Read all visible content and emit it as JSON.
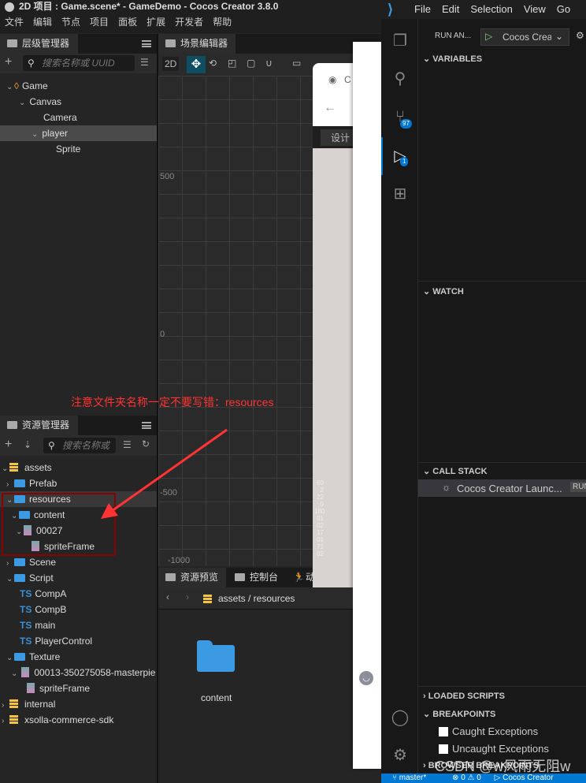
{
  "cocos": {
    "title": "2D 项目 : Game.scene* - GameDemo - Cocos Creator 3.8.0",
    "menu": [
      "文件",
      "编辑",
      "节点",
      "项目",
      "面板",
      "扩展",
      "开发者",
      "帮助"
    ],
    "hierarchy": {
      "tab": "层级管理器",
      "search_placeholder": "搜索名称或 UUID",
      "nodes": [
        {
          "label": "Game"
        },
        {
          "label": "Canvas"
        },
        {
          "label": "Camera"
        },
        {
          "label": "player"
        },
        {
          "label": "Sprite"
        }
      ]
    },
    "scene": {
      "tab": "场景编辑器",
      "mode": "2D",
      "axis_labels": [
        "500",
        "0",
        "-500",
        "-1000"
      ]
    },
    "assets": {
      "tab": "资源管理器",
      "search_placeholder": "搜索名称或",
      "tree": [
        "assets",
        "Prefab",
        "resources",
        "content",
        "00027",
        "spriteFrame",
        "Scene",
        "Script",
        "CompA",
        "CompB",
        "main",
        "PlayerControl",
        "Texture",
        "00013-350275058-masterpie",
        "spriteFrame",
        "internal",
        "xsolla-commerce-sdk"
      ]
    },
    "bottom": {
      "tabs": [
        "资源预览",
        "控制台",
        "动"
      ],
      "breadcrumb": "assets / resources",
      "item": "content"
    },
    "browser": {
      "tab_fragment": "C",
      "button": "设计",
      "side_numbers": [
        "60",
        "2",
        "22",
        "0",
        "180",
        "01",
        "02",
        "17",
        "01",
        "71",
        "02"
      ]
    }
  },
  "annotation": {
    "text": "注意文件夹名称一定不要写错：resources",
    "color": "#ff3333"
  },
  "vscode": {
    "menu": [
      "File",
      "Edit",
      "Selection",
      "View",
      "Go"
    ],
    "run_label": "RUN AN...",
    "config": "Cocos Crea",
    "sections": {
      "variables": "VARIABLES",
      "watch": "WATCH",
      "call_stack": "CALL STACK",
      "loaded_scripts": "LOADED SCRIPTS",
      "breakpoints": "BREAKPOINTS",
      "browser_breakpoints": "BROWSER BREAKPOINTS"
    },
    "call_stack_item": "Cocos Creator Launc...",
    "call_stack_status": "RUN",
    "breakpoints": [
      "Caught Exceptions",
      "Uncaught Exceptions"
    ],
    "badges": {
      "scm": "97",
      "debug": "1"
    },
    "status": {
      "branch": "master*",
      "errors": "0",
      "warnings": "0",
      "launch": "Cocos Creator"
    },
    "accent": "#0078d4"
  },
  "watermark": "CSDN @w风雨无阻w"
}
